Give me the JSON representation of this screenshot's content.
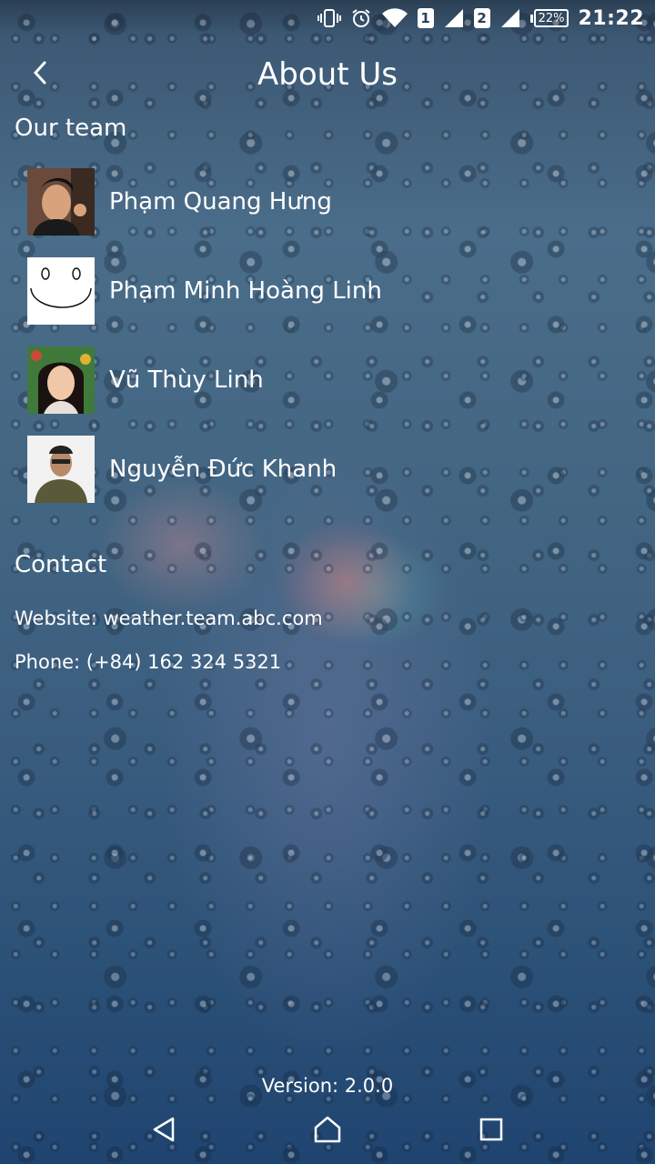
{
  "status_bar": {
    "sim1": "1",
    "sim2": "2",
    "battery": "22%",
    "time": "21:22",
    "icons": [
      "vibrate-icon",
      "alarm-icon",
      "wifi-icon",
      "signal-icon"
    ]
  },
  "header": {
    "title": "About Us",
    "back_icon": "chevron-left-icon"
  },
  "team": {
    "heading": "Our team",
    "members": [
      {
        "name": "Phạm Quang Hưng"
      },
      {
        "name": "Phạm Minh Hoàng Linh"
      },
      {
        "name": "Vũ Thùy Linh"
      },
      {
        "name": "Nguyễn Đức Khanh"
      }
    ]
  },
  "contact": {
    "heading": "Contact",
    "website": "Website: weather.team.abc.com",
    "phone": "Phone: (+84) 162 324 5321"
  },
  "footer": {
    "version": "Version: 2.0.0"
  },
  "nav": {
    "icons": [
      "back-triangle-icon",
      "home-icon",
      "recents-icon"
    ]
  },
  "colors": {
    "text": "#ffffff",
    "background_top": "#3a5570",
    "background_bottom": "#1f4470"
  }
}
